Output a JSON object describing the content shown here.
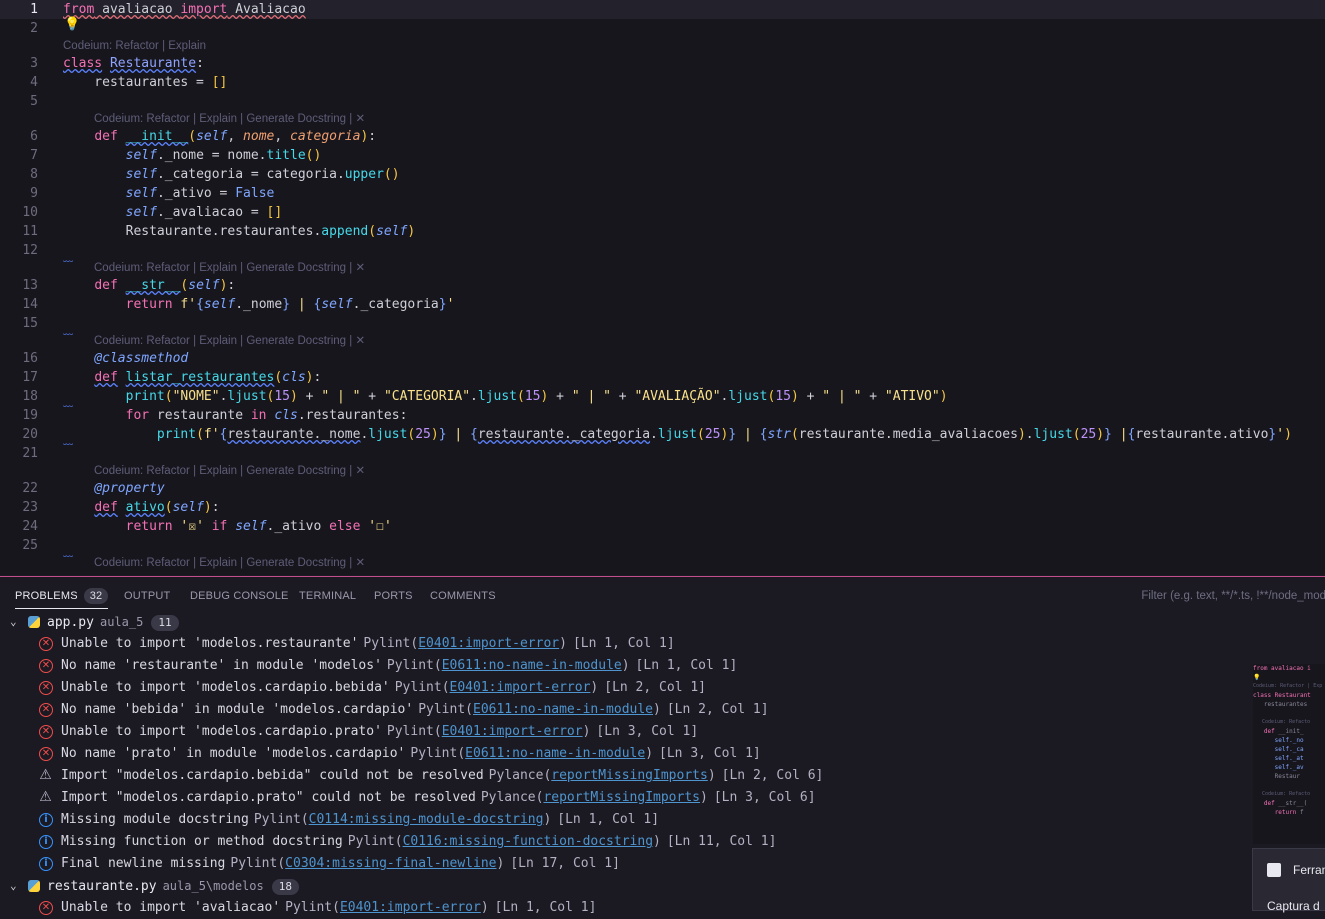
{
  "editor": {
    "lens_short": "Codeium: Refactor | Explain",
    "lens_long": "Codeium: Refactor | Explain | Generate Docstring | ✕",
    "lines": [
      {
        "n": "1"
      },
      {
        "n": "2"
      },
      {
        "n": "3"
      },
      {
        "n": "4"
      },
      {
        "n": "5"
      },
      {
        "n": "6"
      },
      {
        "n": "7"
      },
      {
        "n": "8"
      },
      {
        "n": "9"
      },
      {
        "n": "10"
      },
      {
        "n": "11"
      },
      {
        "n": "12"
      },
      {
        "n": "13"
      },
      {
        "n": "14"
      },
      {
        "n": "15"
      },
      {
        "n": "16"
      },
      {
        "n": "17"
      },
      {
        "n": "18"
      },
      {
        "n": "19"
      },
      {
        "n": "20"
      },
      {
        "n": "21"
      },
      {
        "n": "22"
      },
      {
        "n": "23"
      },
      {
        "n": "24"
      },
      {
        "n": "25"
      }
    ]
  },
  "panel": {
    "tabs": [
      {
        "label": "PROBLEMS",
        "badge": "32"
      },
      {
        "label": "OUTPUT"
      },
      {
        "label": "DEBUG CONSOLE"
      },
      {
        "label": "TERMINAL"
      },
      {
        "label": "PORTS"
      },
      {
        "label": "COMMENTS"
      }
    ],
    "filter_placeholder": "Filter (e.g. text, **/*.ts, !**/node_modul",
    "groups": [
      {
        "file": "app.py",
        "dir": "aula_5",
        "count": "11",
        "items": [
          {
            "sev": "error",
            "msg": "Unable to import 'modelos.restaurante'",
            "src": "Pylint",
            "code": "E0401:import-error",
            "pos": "[Ln 1, Col 1]"
          },
          {
            "sev": "error",
            "msg": "No name 'restaurante' in module 'modelos'",
            "src": "Pylint",
            "code": "E0611:no-name-in-module",
            "pos": "[Ln 1, Col 1]"
          },
          {
            "sev": "error",
            "msg": "Unable to import 'modelos.cardapio.bebida'",
            "src": "Pylint",
            "code": "E0401:import-error",
            "pos": "[Ln 2, Col 1]"
          },
          {
            "sev": "error",
            "msg": "No name 'bebida' in module 'modelos.cardapio'",
            "src": "Pylint",
            "code": "E0611:no-name-in-module",
            "pos": "[Ln 2, Col 1]"
          },
          {
            "sev": "error",
            "msg": "Unable to import 'modelos.cardapio.prato'",
            "src": "Pylint",
            "code": "E0401:import-error",
            "pos": "[Ln 3, Col 1]"
          },
          {
            "sev": "error",
            "msg": "No name 'prato' in module 'modelos.cardapio'",
            "src": "Pylint",
            "code": "E0611:no-name-in-module",
            "pos": "[Ln 3, Col 1]"
          },
          {
            "sev": "warning",
            "msg": "Import \"modelos.cardapio.bebida\" could not be resolved",
            "src": "Pylance",
            "code": "reportMissingImports",
            "pos": "[Ln 2, Col 6]"
          },
          {
            "sev": "warning",
            "msg": "Import \"modelos.cardapio.prato\" could not be resolved",
            "src": "Pylance",
            "code": "reportMissingImports",
            "pos": "[Ln 3, Col 6]"
          },
          {
            "sev": "info",
            "msg": "Missing module docstring",
            "src": "Pylint",
            "code": "C0114:missing-module-docstring",
            "pos": "[Ln 1, Col 1]"
          },
          {
            "sev": "info",
            "msg": "Missing function or method docstring",
            "src": "Pylint",
            "code": "C0116:missing-function-docstring",
            "pos": "[Ln 11, Col 1]"
          },
          {
            "sev": "info",
            "msg": "Final newline missing",
            "src": "Pylint",
            "code": "C0304:missing-final-newline",
            "pos": "[Ln 17, Col 1]"
          }
        ]
      },
      {
        "file": "restaurante.py",
        "dir": "aula_5\\modelos",
        "count": "18",
        "items": [
          {
            "sev": "error",
            "msg": "Unable to import 'avaliacao'",
            "src": "Pylint",
            "code": "E0401:import-error",
            "pos": "[Ln 1, Col 1]"
          }
        ]
      }
    ]
  },
  "toast": {
    "title": "Ferran",
    "subtitle": "Captura d"
  }
}
